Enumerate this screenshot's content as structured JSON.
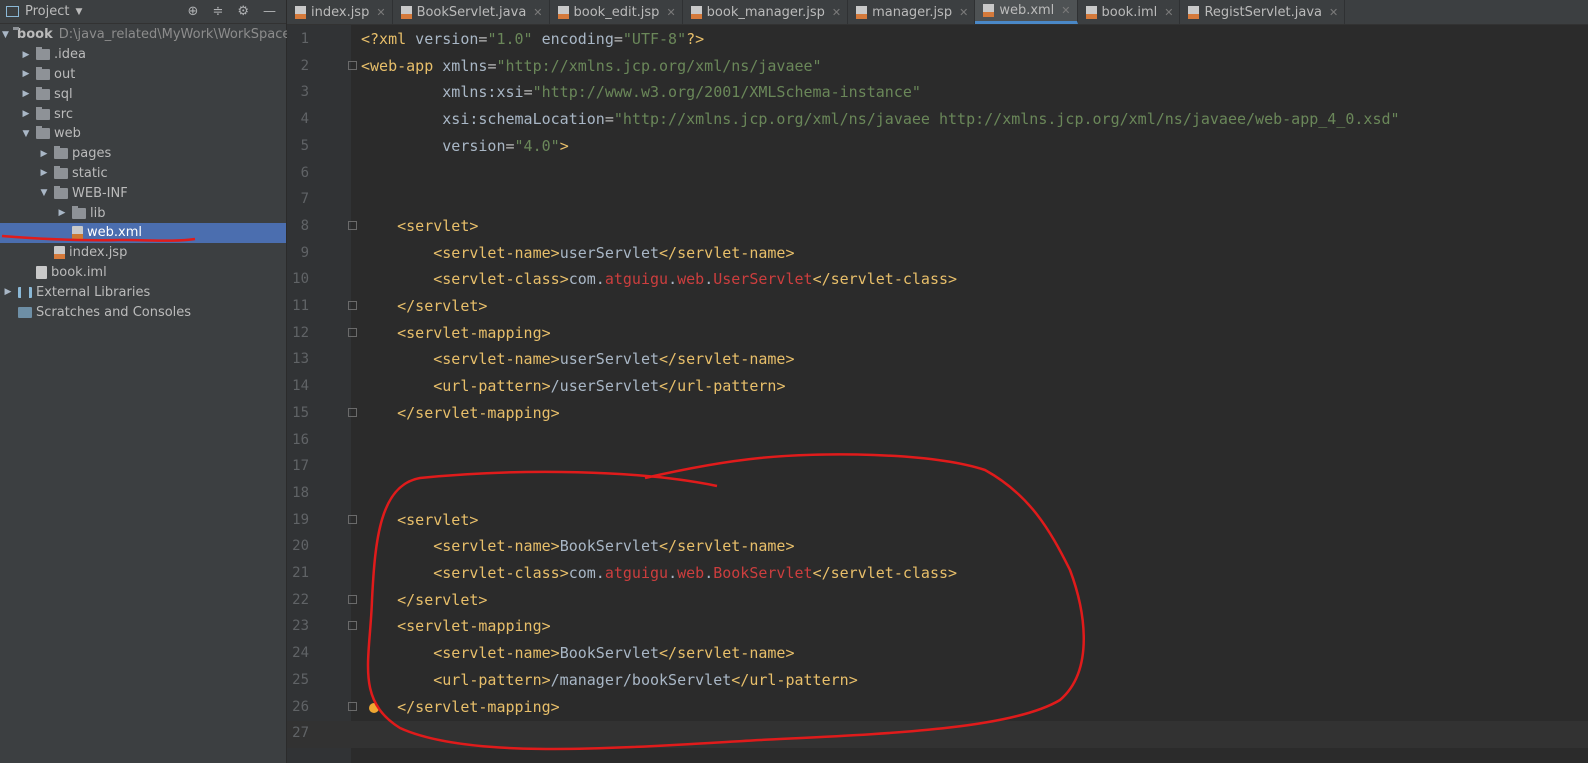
{
  "project": {
    "title": "Project",
    "root_name": "book",
    "root_path": "D:\\java_related\\MyWork\\WorkSpace\\",
    "items": [
      {
        "label": "book",
        "hint": "D:\\java_related\\MyWork\\WorkSpace\\",
        "icon": "module-folder-icon",
        "level": 0,
        "expanded": true
      },
      {
        "label": ".idea",
        "icon": "folder-icon",
        "level": 1,
        "expanded": false
      },
      {
        "label": "out",
        "icon": "folder-icon",
        "level": 1,
        "expanded": false
      },
      {
        "label": "sql",
        "icon": "folder-icon",
        "level": 1,
        "expanded": false
      },
      {
        "label": "src",
        "icon": "folder-icon",
        "level": 1,
        "expanded": false
      },
      {
        "label": "web",
        "icon": "folder-icon",
        "level": 1,
        "expanded": true
      },
      {
        "label": "pages",
        "icon": "folder-icon",
        "level": 2,
        "expanded": false
      },
      {
        "label": "static",
        "icon": "folder-icon",
        "level": 2,
        "expanded": false
      },
      {
        "label": "WEB-INF",
        "icon": "folder-icon",
        "level": 2,
        "expanded": true
      },
      {
        "label": "lib",
        "icon": "folder-icon",
        "level": 3,
        "expanded": false
      },
      {
        "label": "web.xml",
        "icon": "xml-file-icon",
        "level": 3,
        "selected": true
      },
      {
        "label": "index.jsp",
        "icon": "jsp-file-icon",
        "level": 2
      },
      {
        "label": "book.iml",
        "icon": "iml-file-icon",
        "level": 1
      },
      {
        "label": "External Libraries",
        "icon": "library-icon",
        "level": 0,
        "expanded": false
      },
      {
        "label": "Scratches and Consoles",
        "icon": "scratch-icon",
        "level": 0
      }
    ]
  },
  "tabs": [
    {
      "label": "index.jsp",
      "icon": "jsp-file-icon"
    },
    {
      "label": "BookServlet.java",
      "icon": "java-file-icon"
    },
    {
      "label": "book_edit.jsp",
      "icon": "jsp-file-icon"
    },
    {
      "label": "book_manager.jsp",
      "icon": "jsp-file-icon"
    },
    {
      "label": "manager.jsp",
      "icon": "jsp-file-icon"
    },
    {
      "label": "web.xml",
      "icon": "xml-file-icon",
      "active": true
    },
    {
      "label": "book.iml",
      "icon": "iml-file-icon"
    },
    {
      "label": "RegistServlet.java",
      "icon": "java-file-icon"
    }
  ],
  "editor": {
    "lines": [
      {
        "n": "1",
        "text": "<?xml version=\"1.0\" encoding=\"UTF-8\"?>"
      },
      {
        "n": "2",
        "text": "<web-app xmlns=\"http://xmlns.jcp.org/xml/ns/javaee\""
      },
      {
        "n": "3",
        "text": "         xmlns:xsi=\"http://www.w3.org/2001/XMLSchema-instance\""
      },
      {
        "n": "4",
        "text": "         xsi:schemaLocation=\"http://xmlns.jcp.org/xml/ns/javaee http://xmlns.jcp.org/xml/ns/javaee/web-app_4_0.xsd\""
      },
      {
        "n": "5",
        "text": "         version=\"4.0\">"
      },
      {
        "n": "6",
        "text": ""
      },
      {
        "n": "7",
        "text": ""
      },
      {
        "n": "8",
        "text": "    <servlet>"
      },
      {
        "n": "9",
        "text": "        <servlet-name>userServlet</servlet-name>"
      },
      {
        "n": "10",
        "text": "        <servlet-class>com.atguigu.web.UserServlet</servlet-class>"
      },
      {
        "n": "11",
        "text": "    </servlet>"
      },
      {
        "n": "12",
        "text": "    <servlet-mapping>"
      },
      {
        "n": "13",
        "text": "        <servlet-name>userServlet</servlet-name>"
      },
      {
        "n": "14",
        "text": "        <url-pattern>/userServlet</url-pattern>"
      },
      {
        "n": "15",
        "text": "    </servlet-mapping>"
      },
      {
        "n": "16",
        "text": ""
      },
      {
        "n": "17",
        "text": ""
      },
      {
        "n": "18",
        "text": ""
      },
      {
        "n": "19",
        "text": "    <servlet>"
      },
      {
        "n": "20",
        "text": "        <servlet-name>BookServlet</servlet-name>"
      },
      {
        "n": "21",
        "text": "        <servlet-class>com.atguigu.web.BookServlet</servlet-class>"
      },
      {
        "n": "22",
        "text": "    </servlet>"
      },
      {
        "n": "23",
        "text": "    <servlet-mapping>"
      },
      {
        "n": "24",
        "text": "        <servlet-name>BookServlet</servlet-name>"
      },
      {
        "n": "25",
        "text": "        <url-pattern>/manager/bookServlet</url-pattern>"
      },
      {
        "n": "26",
        "text": "    </servlet-mapping>"
      },
      {
        "n": "27",
        "text": ""
      }
    ]
  },
  "colors": {
    "background": "#2b2b2b",
    "panel": "#3c3f41",
    "selection": "#4b6eaf",
    "tag": "#e8bf6a",
    "string": "#6a8759",
    "annotation": "#e01b1b"
  }
}
